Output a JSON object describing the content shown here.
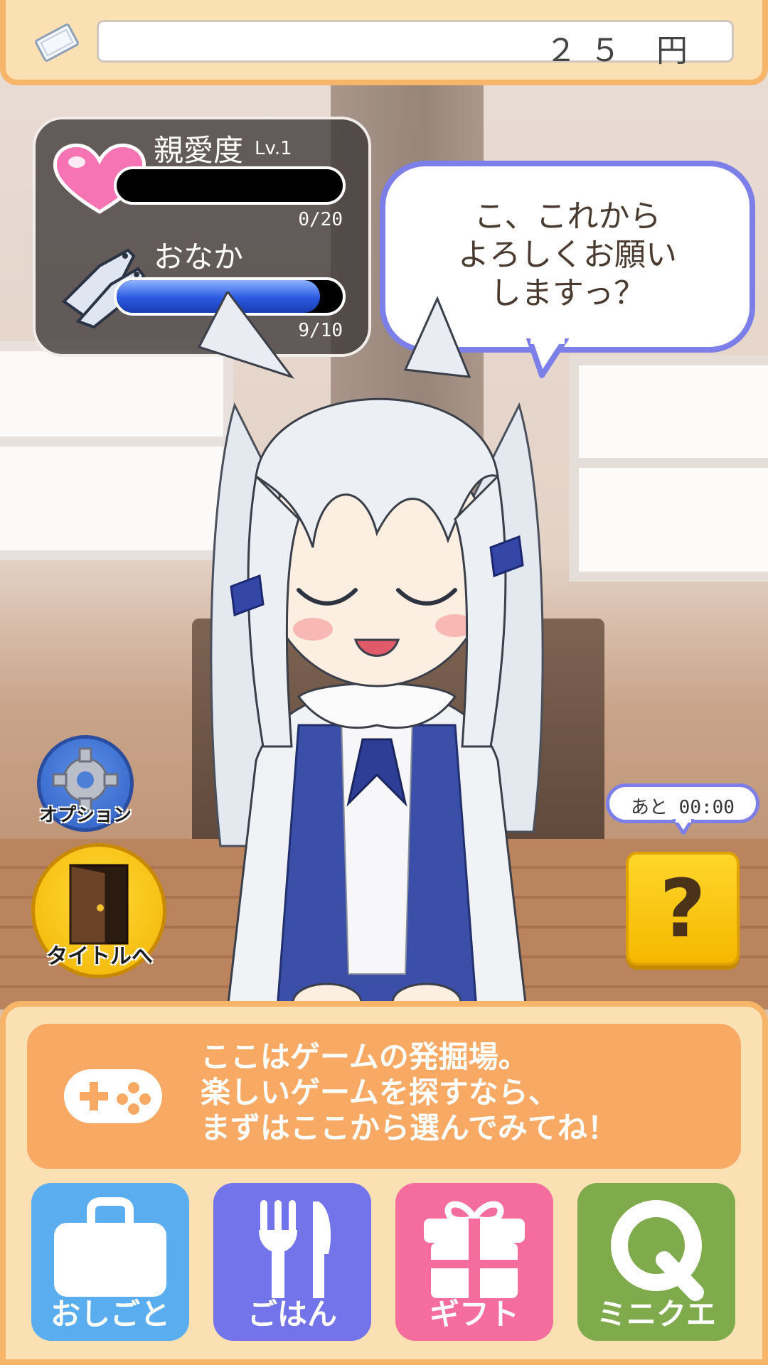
{
  "topbar": {
    "money": "２５ 円"
  },
  "status": {
    "affection_label": "親愛度",
    "affection_level": "Lv.1",
    "affection_count": "0/20",
    "affection_progress": 0,
    "hunger_label": "おなか",
    "hunger_count": "9/10",
    "hunger_progress": 0.9
  },
  "speech": {
    "text": "こ、これから\nよろしくお願い\nしますっ？"
  },
  "side": {
    "option_label": "オプション",
    "title_label": "タイトルへ"
  },
  "timer": {
    "text": "あと 00:00"
  },
  "mystery": {
    "label": "?"
  },
  "info": {
    "text": "ここはゲームの発掘場。\n楽しいゲームを探すなら、\nまずはここから選んでみてね！"
  },
  "menu": [
    {
      "label": "おしごと",
      "icon": "briefcase-icon"
    },
    {
      "label": "ごはん",
      "icon": "fork-knife-icon"
    },
    {
      "label": "ギフト",
      "icon": "gift-icon"
    },
    {
      "label": "ミニクエ",
      "icon": "q-icon"
    }
  ],
  "colors": {
    "panel_border": "#f7b56a",
    "panel_bg": "#fbe0b4",
    "bubble_border": "#7d7fe8",
    "bar_fill": "#2a59e0",
    "work": "#5aaef0",
    "meal": "#7373ea",
    "gift": "#f56d9d",
    "quest": "#7fab4d"
  }
}
